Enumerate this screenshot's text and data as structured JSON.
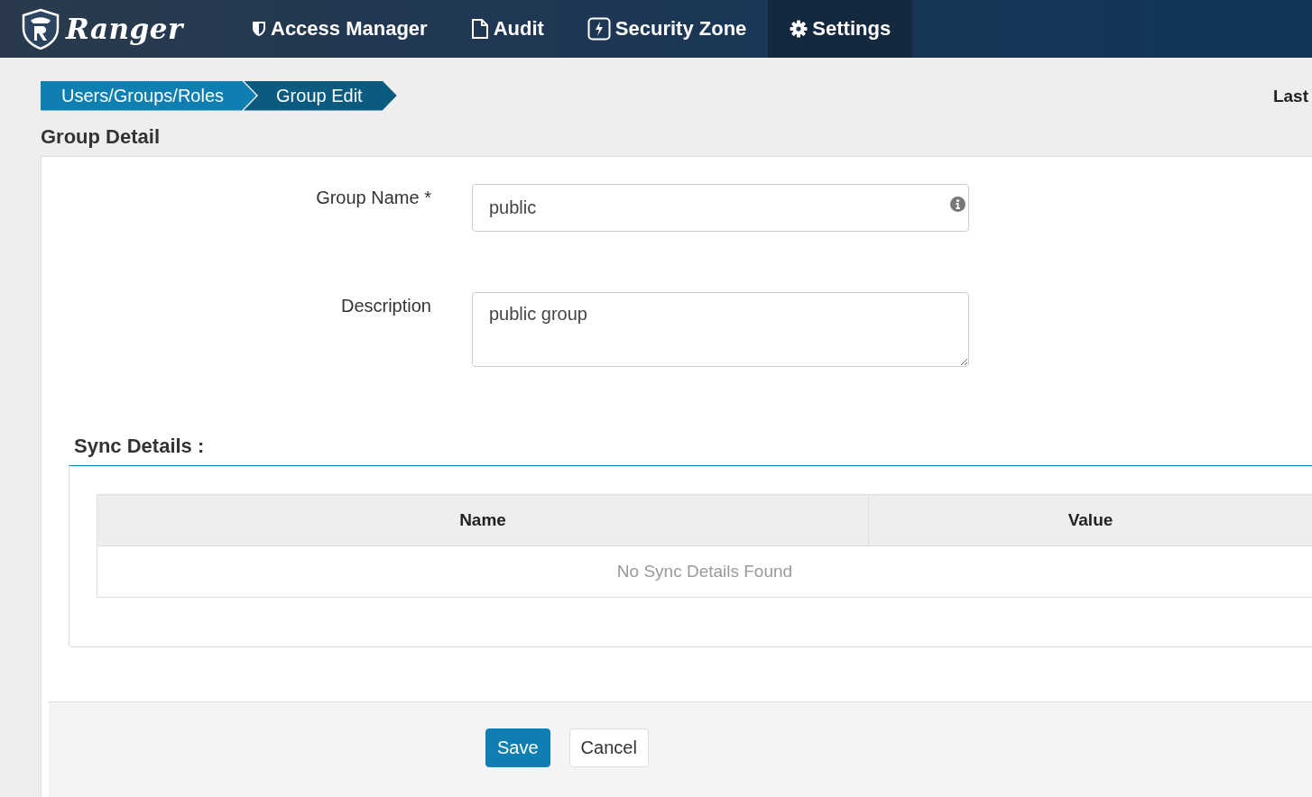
{
  "navbar": {
    "brand": "Ranger",
    "items": [
      {
        "label": "Access Manager",
        "selected": false
      },
      {
        "label": "Audit",
        "selected": false
      },
      {
        "label": "Security Zone",
        "selected": false
      },
      {
        "label": "Settings",
        "selected": true
      }
    ]
  },
  "breadcrumb": [
    {
      "label": "Users/Groups/Roles",
      "current": false
    },
    {
      "label": "Group Edit",
      "current": true
    }
  ],
  "top_right_text": "Last",
  "page_title": "Group Detail",
  "form": {
    "fields": [
      {
        "kind": "input",
        "label": "Group Name *",
        "value": "public"
      },
      {
        "kind": "textarea",
        "label": "Description",
        "value": "public group"
      }
    ]
  },
  "sync_details": {
    "title": "Sync Details :",
    "table": {
      "columns": [
        "Name",
        "Value"
      ],
      "empty_message": "No Sync Details Found"
    }
  },
  "buttons": [
    {
      "label": "Save",
      "kind": "primary"
    },
    {
      "label": "Cancel",
      "kind": "default"
    }
  ]
}
